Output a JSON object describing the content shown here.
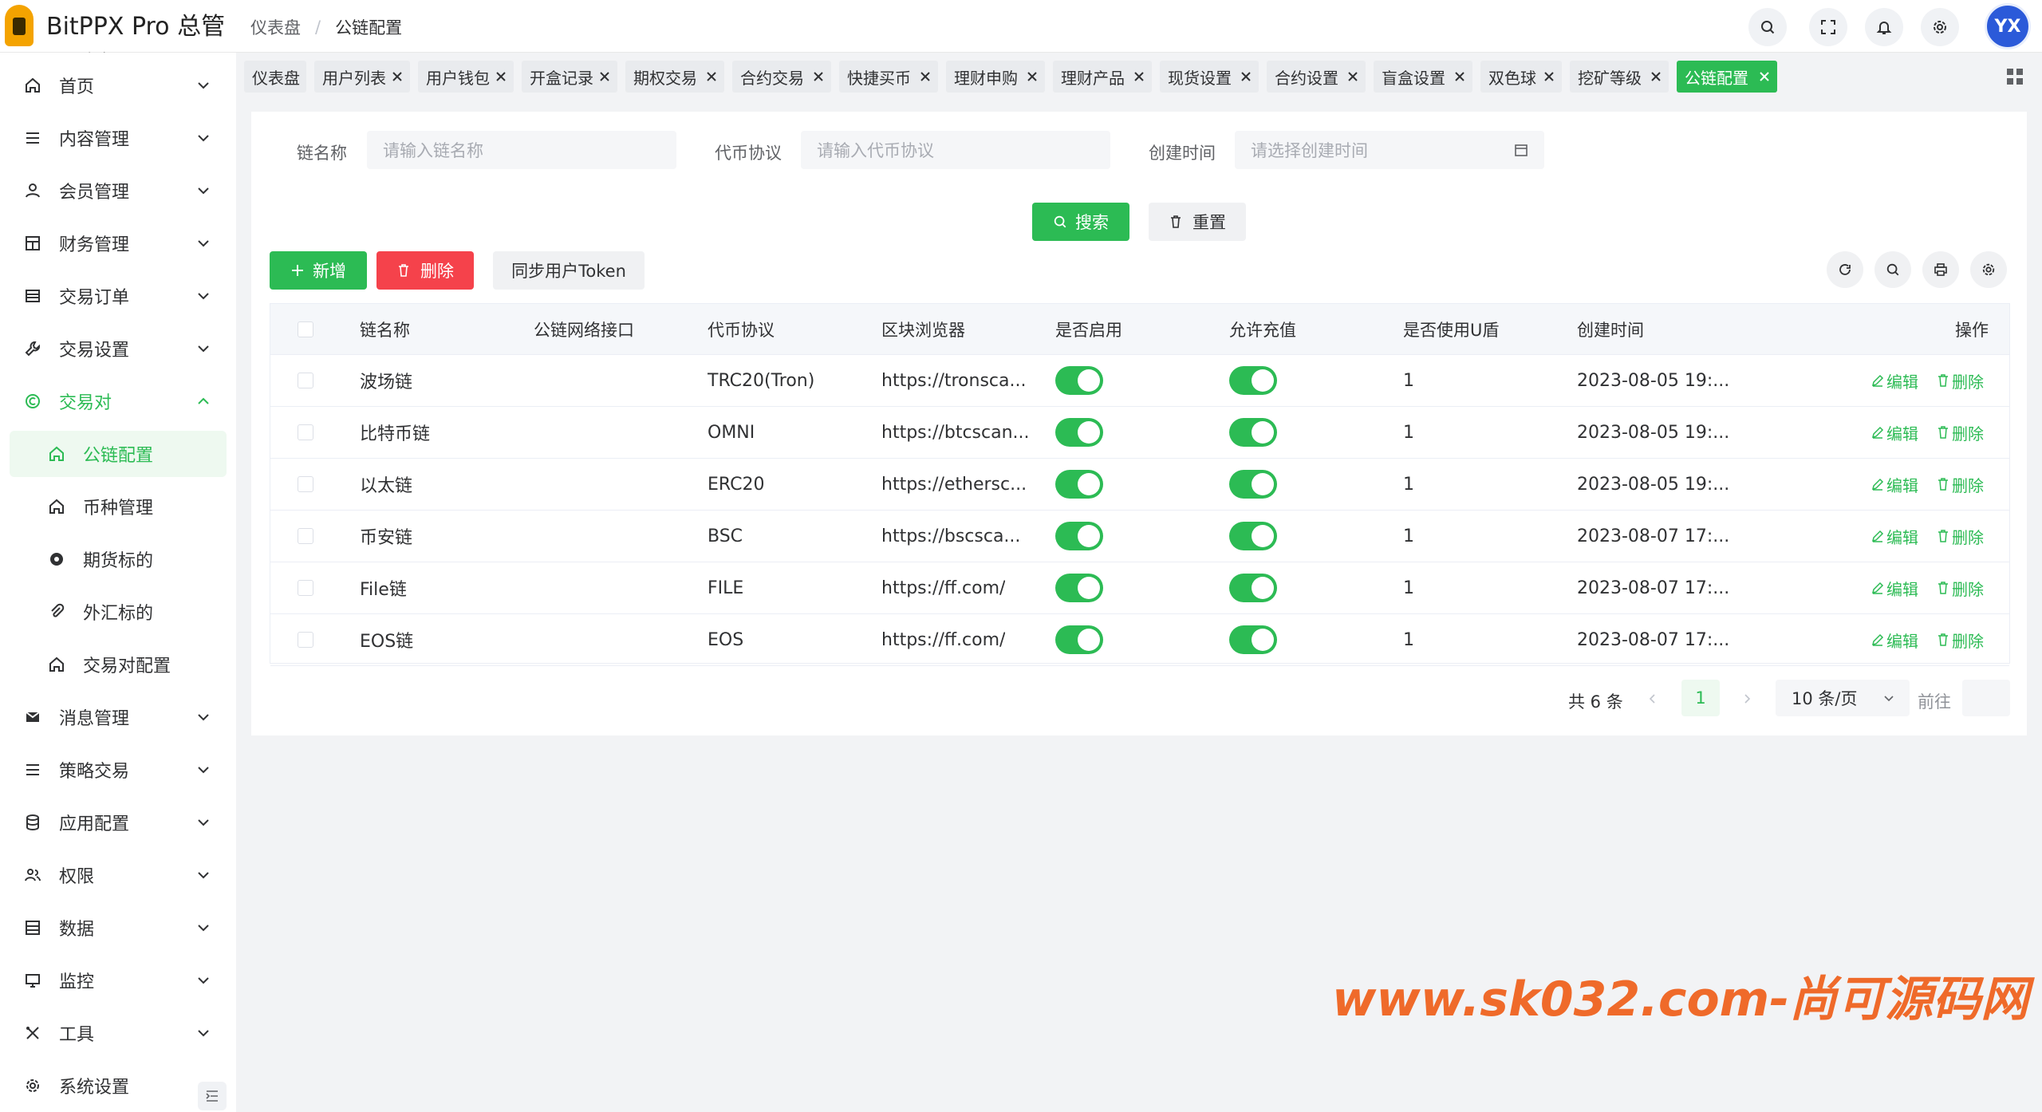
{
  "app": {
    "title": "BitPPX Pro 总管理后台"
  },
  "breadcrumb": {
    "home": "仪表盘",
    "sep": "/",
    "current": "公链配置"
  },
  "sidebar": {
    "items": [
      {
        "label": "首页",
        "icon": "home-icon"
      },
      {
        "label": "内容管理",
        "icon": "list-icon"
      },
      {
        "label": "会员管理",
        "icon": "user-icon"
      },
      {
        "label": "财务管理",
        "icon": "finance-icon"
      },
      {
        "label": "交易订单",
        "icon": "order-icon"
      },
      {
        "label": "交易设置",
        "icon": "wrench-icon"
      },
      {
        "label": "交易对",
        "icon": "copyright-icon"
      },
      {
        "label": "公链配置",
        "icon": "home-icon"
      },
      {
        "label": "币种管理",
        "icon": "home-icon"
      },
      {
        "label": "期货标的",
        "icon": "github-icon"
      },
      {
        "label": "外汇标的",
        "icon": "paperclip-icon"
      },
      {
        "label": "交易对配置",
        "icon": "home-icon"
      },
      {
        "label": "消息管理",
        "icon": "message-icon"
      },
      {
        "label": "策略交易",
        "icon": "list-icon"
      },
      {
        "label": "应用配置",
        "icon": "database-icon"
      },
      {
        "label": "权限",
        "icon": "users-icon"
      },
      {
        "label": "数据",
        "icon": "data-icon"
      },
      {
        "label": "监控",
        "icon": "monitor-icon"
      },
      {
        "label": "工具",
        "icon": "tools-icon"
      },
      {
        "label": "系统设置",
        "icon": "gear-icon"
      }
    ]
  },
  "tags": [
    "仪表盘",
    "用户列表",
    "用户钱包",
    "开盒记录",
    "期权交易",
    "合约交易",
    "快捷买币",
    "理财申购",
    "理财产品",
    "现货设置",
    "合约设置",
    "盲盒设置",
    "双色球",
    "挖矿等级",
    "公链配置"
  ],
  "filters": {
    "chain_name_label": "链名称",
    "chain_name_placeholder": "请输入链名称",
    "protocol_label": "代币协议",
    "protocol_placeholder": "请输入代币协议",
    "created_label": "创建时间",
    "created_placeholder": "请选择创建时间",
    "search_label": "搜索",
    "reset_label": "重置"
  },
  "toolbar": {
    "add_label": "新增",
    "delete_label": "删除",
    "sync_label": "同步用户Token"
  },
  "table": {
    "headers": [
      "链名称",
      "公链网络接口",
      "代币协议",
      "区块浏览器",
      "是否启用",
      "允许充值",
      "是否使用U盾",
      "创建时间",
      "操作"
    ],
    "rows": [
      {
        "name": "波场链",
        "api": "",
        "protocol": "TRC20(Tron)",
        "explorer": "https://tronsca...",
        "enabled": true,
        "recharge": true,
        "ukey": "1",
        "created": "2023-08-05 19:..."
      },
      {
        "name": "比特币链",
        "api": "",
        "protocol": "OMNI",
        "explorer": "https://btcscan...",
        "enabled": true,
        "recharge": true,
        "ukey": "1",
        "created": "2023-08-05 19:..."
      },
      {
        "name": "以太链",
        "api": "",
        "protocol": "ERC20",
        "explorer": "https://ethersc...",
        "enabled": true,
        "recharge": true,
        "ukey": "1",
        "created": "2023-08-05 19:..."
      },
      {
        "name": "币安链",
        "api": "",
        "protocol": "BSC",
        "explorer": "https://bscsca...",
        "enabled": true,
        "recharge": true,
        "ukey": "1",
        "created": "2023-08-07 17:..."
      },
      {
        "name": "File链",
        "api": "",
        "protocol": "FILE",
        "explorer": "https://ff.com/",
        "enabled": true,
        "recharge": true,
        "ukey": "1",
        "created": "2023-08-07 17:..."
      },
      {
        "name": "EOS链",
        "api": "",
        "protocol": "EOS",
        "explorer": "https://ff.com/",
        "enabled": true,
        "recharge": true,
        "ukey": "1",
        "created": "2023-08-07 17:..."
      }
    ],
    "edit_label": "编辑",
    "delete_label": "删除"
  },
  "pagination": {
    "total": "共 6 条",
    "current_page": "1",
    "page_size": "10 条/页",
    "goto_label": "前往"
  },
  "watermark": "www.sk032.com-尚可源码网",
  "colors": {
    "accent": "#2cbb54",
    "danger": "#f5424b",
    "watermark": "#ef6a2a"
  }
}
